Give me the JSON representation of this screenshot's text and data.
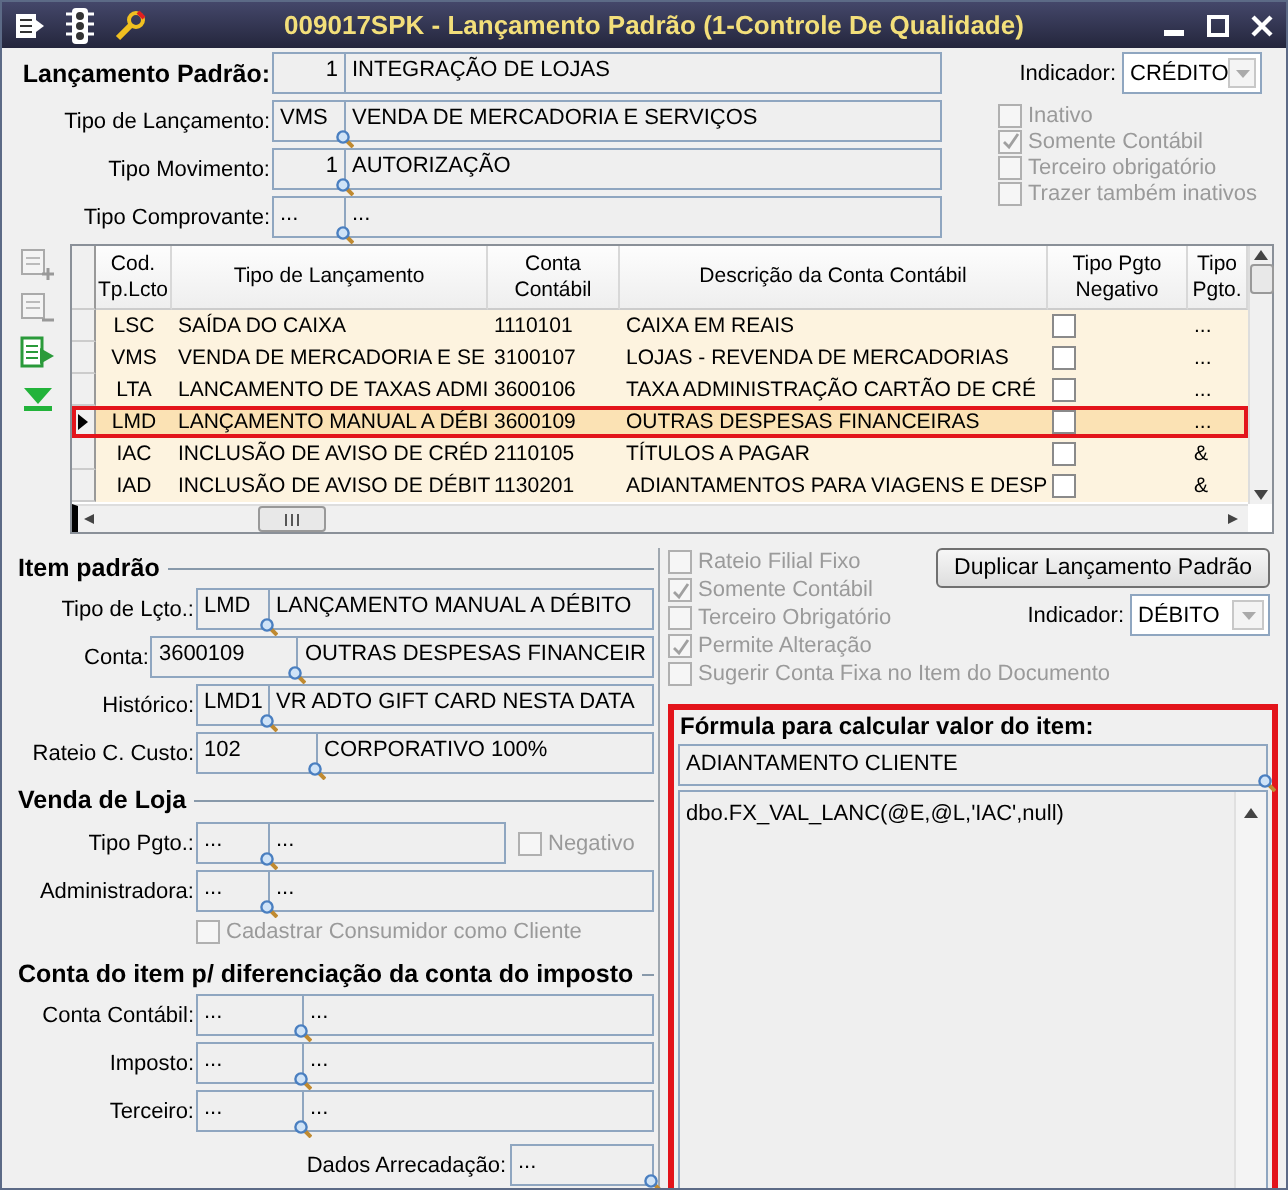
{
  "window": {
    "title": "009017SPK - Lançamento Padrão (1-Controle De Qualidade)"
  },
  "header_form": {
    "fields": [
      {
        "label": "Lançamento Padrão:",
        "code": "1",
        "description": "INTEGRAÇÃO DE LOJAS",
        "kind": "key",
        "numeric": true
      },
      {
        "label": "Tipo de Lançamento:",
        "code": "VMS",
        "description": "VENDA DE MERCADORIA E SERVIÇOS",
        "kind": "lookup",
        "numeric": false
      },
      {
        "label": "Tipo Movimento:",
        "code": "1",
        "description": "AUTORIZAÇÃO",
        "kind": "lookup",
        "numeric": true
      },
      {
        "label": "Tipo Comprovante:",
        "code": "...",
        "description": "...",
        "kind": "lookup",
        "numeric": false
      }
    ],
    "indicator": {
      "label": "Indicador:",
      "value": "CRÉDITO"
    },
    "options": [
      {
        "label": "Inativo",
        "checked": false,
        "disabled": true
      },
      {
        "label": "Somente Contábil",
        "checked": true,
        "disabled": true
      },
      {
        "label": "Terceiro obrigatório",
        "checked": false,
        "disabled": true
      },
      {
        "label": "Trazer também inativos",
        "checked": false,
        "disabled": true
      }
    ]
  },
  "grid": {
    "columns": [
      "Cod. Tp.Lcto",
      "Tipo de Lançamento",
      "Conta Contábil",
      "Descrição da Conta Contábil",
      "Tipo Pgto Negativo",
      "Tipo Pgto."
    ],
    "rows": [
      {
        "code": "LSC",
        "tipo": "SAÍDA DO CAIXA",
        "conta": "1110101",
        "descricao": "CAIXA EM REAIS",
        "negativo": false,
        "tipo_pgto": "...",
        "selected": false
      },
      {
        "code": "VMS",
        "tipo": "VENDA DE MERCADORIA E SE",
        "conta": "3100107",
        "descricao": "LOJAS - REVENDA DE MERCADORIAS",
        "negativo": false,
        "tipo_pgto": "...",
        "selected": false
      },
      {
        "code": "LTA",
        "tipo": "LANCAMENTO DE TAXAS ADMI",
        "conta": "3600106",
        "descricao": "TAXA ADMINISTRAÇÃO CARTÃO DE CRÉ",
        "negativo": false,
        "tipo_pgto": "...",
        "selected": false
      },
      {
        "code": "LMD",
        "tipo": "LANÇAMENTO MANUAL A DÉBI",
        "conta": "3600109",
        "descricao": "OUTRAS DESPESAS FINANCEIRAS",
        "negativo": false,
        "tipo_pgto": "...",
        "selected": true
      },
      {
        "code": "IAC",
        "tipo": "INCLUSÃO DE AVISO DE CRÉD",
        "conta": "2110105",
        "descricao": "TÍTULOS A PAGAR",
        "negativo": false,
        "tipo_pgto": "&",
        "selected": false
      },
      {
        "code": "IAD",
        "tipo": "INCLUSÃO DE AVISO DE DÉBIT",
        "conta": "1130201",
        "descricao": "ADIANTAMENTOS PARA VIAGENS E DESP",
        "negativo": false,
        "tipo_pgto": "&",
        "selected": false
      }
    ]
  },
  "item_padrao": {
    "title": "Item padrão",
    "fields": [
      {
        "label": "Tipo de Lçto.:",
        "code": "LMD",
        "description": "LANÇAMENTO MANUAL A DÉBITO"
      },
      {
        "label": "Conta:",
        "code": "3600109",
        "description": "OUTRAS DESPESAS FINANCEIR"
      },
      {
        "label": "Histórico:",
        "code": "LMD1",
        "description": "VR ADTO GIFT CARD NESTA DATA"
      },
      {
        "label": "Rateio C. Custo:",
        "code": "102",
        "description": "CORPORATIVO 100%"
      }
    ]
  },
  "venda_de_loja": {
    "title": "Venda de Loja",
    "fields": [
      {
        "label": "Tipo Pgto.:",
        "code": "...",
        "description": "...",
        "option": {
          "label": "Negativo",
          "checked": false,
          "disabled": true
        }
      },
      {
        "label": "Administradora:",
        "code": "...",
        "description": "..."
      }
    ],
    "cadastrar": {
      "label": "Cadastrar Consumidor como Cliente",
      "checked": false,
      "disabled": true
    }
  },
  "conta_imposto": {
    "title": "Conta do item p/ diferenciação da conta do imposto",
    "fields": [
      {
        "label": "Conta Contábil:",
        "code": "...",
        "description": "..."
      },
      {
        "label": "Imposto:",
        "code": "...",
        "description": "..."
      },
      {
        "label": "Terceiro:",
        "code": "...",
        "description": "..."
      }
    ],
    "dados_arrecadacao": {
      "label": "Dados Arrecadação:",
      "value": "..."
    }
  },
  "right_panel": {
    "options": [
      {
        "label": "Rateio Filial Fixo",
        "checked": false,
        "disabled": true
      },
      {
        "label": "Somente Contábil",
        "checked": true,
        "disabled": true
      },
      {
        "label": "Terceiro Obrigatório",
        "checked": false,
        "disabled": true
      },
      {
        "label": "Permite Alteração",
        "checked": true,
        "disabled": true
      },
      {
        "label": "Sugerir Conta Fixa no Item do Documento",
        "checked": false,
        "disabled": true
      }
    ],
    "duplicate_button": "Duplicar Lançamento Padrão",
    "indicator": {
      "label": "Indicador:",
      "value": "DÉBITO"
    },
    "formula": {
      "title": "Fórmula para calcular valor do item:",
      "name": "ADIANTAMENTO CLIENTE",
      "expression": "dbo.FX_VAL_LANC(@E,@L,'IAC',null)"
    }
  }
}
